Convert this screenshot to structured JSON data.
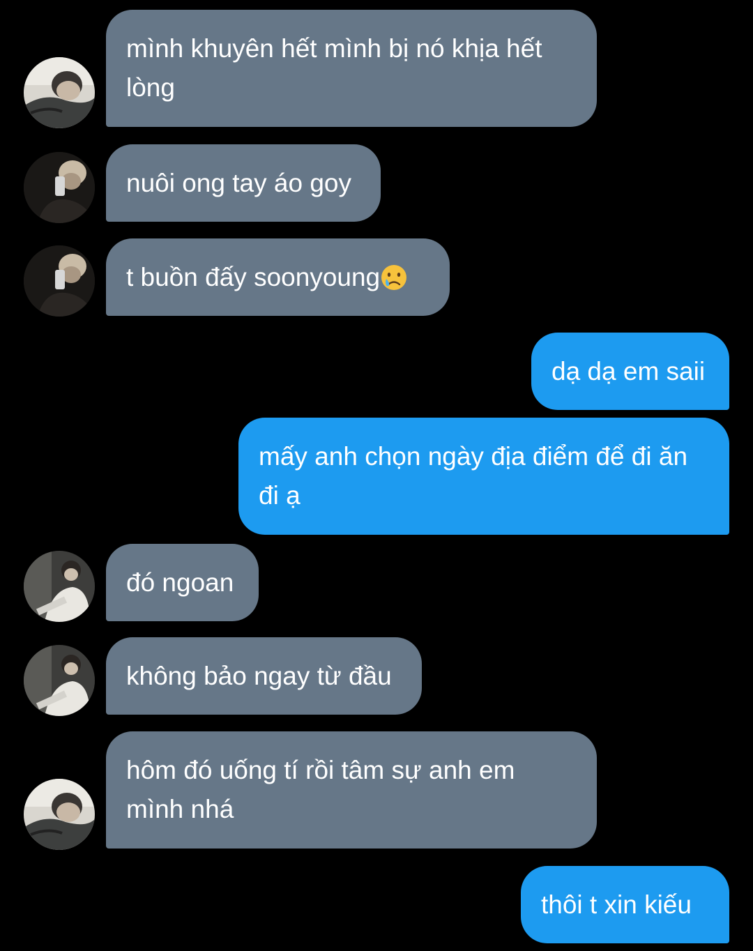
{
  "colors": {
    "background": "#000000",
    "incoming_bubble": "#667788",
    "outgoing_bubble": "#1d9bf0",
    "text": "#ffffff"
  },
  "messages": [
    {
      "side": "incoming",
      "text": "mình khuyên hết mình bị nó khịa hết lòng"
    },
    {
      "side": "incoming",
      "text": "nuôi ong tay áo goy"
    },
    {
      "side": "incoming",
      "text": "t buồn đấy soonyoung",
      "emoji": "crying-face-emoji"
    },
    {
      "side": "outgoing",
      "text": "dạ dạ em saii"
    },
    {
      "side": "outgoing",
      "text": "mấy anh chọn ngày địa điểm để đi ăn đi ạ"
    },
    {
      "side": "incoming",
      "text": "đó ngoan"
    },
    {
      "side": "incoming",
      "text": "không bảo ngay từ đầu"
    },
    {
      "side": "incoming",
      "text": "hôm đó uống tí rồi tâm sự anh em mình nhá"
    },
    {
      "side": "outgoing",
      "text": "thôi t xin kiếu"
    }
  ]
}
